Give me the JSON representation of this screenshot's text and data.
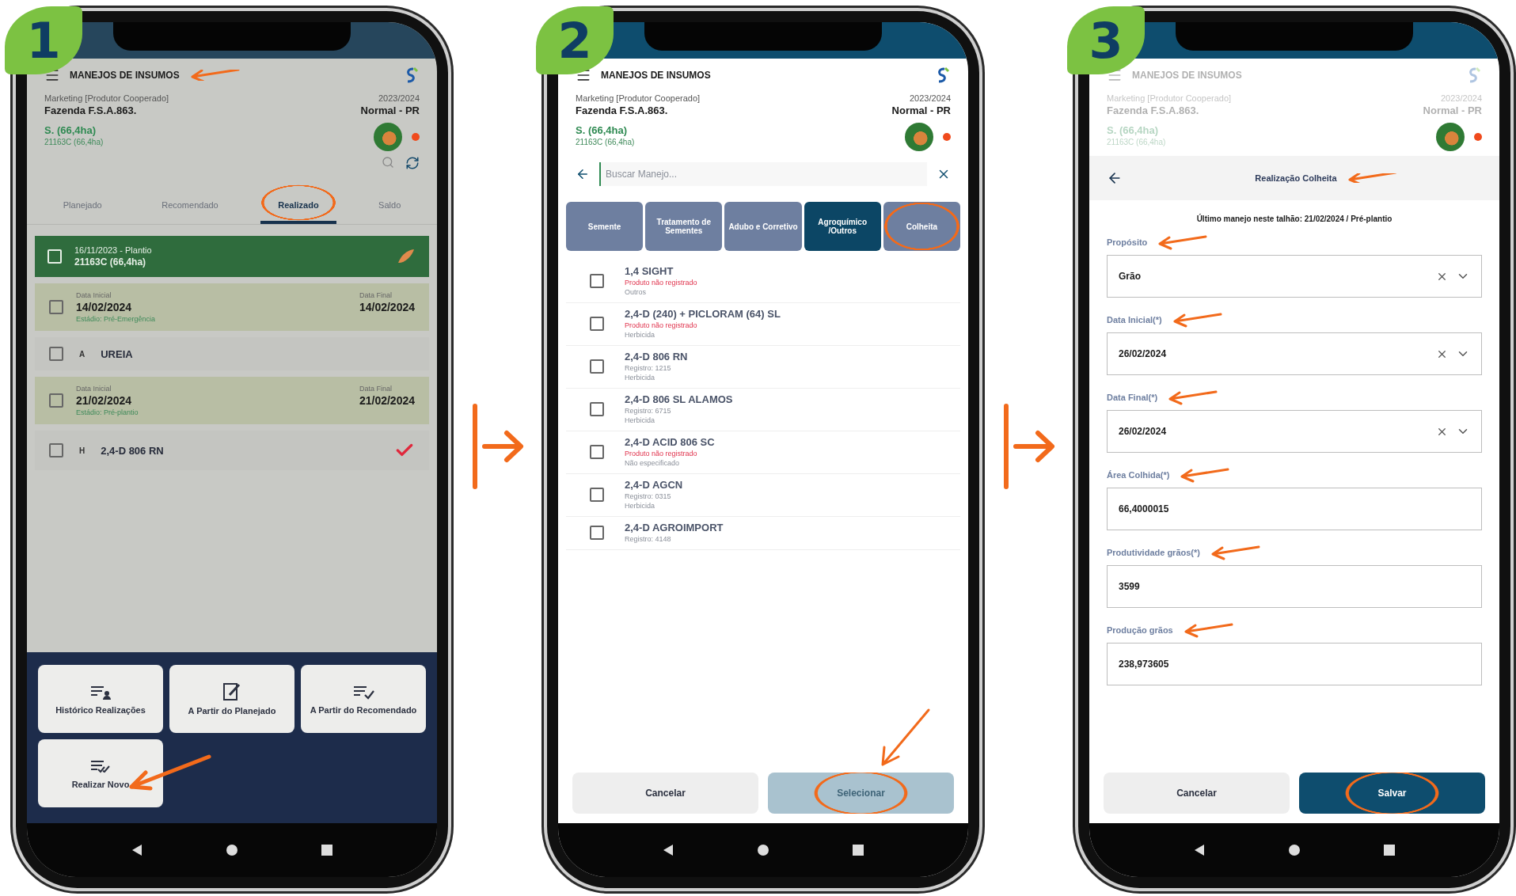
{
  "steps": [
    {
      "number": "1",
      "kind": "list",
      "header": {
        "title": "MANEJOS DE INSUMOS",
        "pointed": true,
        "faded": false
      },
      "farm": {
        "group": "Marketing [Produtor Cooperado]",
        "name": "Fazenda F.S.A.863.",
        "field": "S. (66,4ha)",
        "plot": "21163C (66,4ha)",
        "season": "2023/2024",
        "region": "Normal - PR"
      },
      "tabs": [
        {
          "label": "Planejado",
          "selected": false,
          "circled": false
        },
        {
          "label": "Recomendado",
          "selected": false,
          "circled": false
        },
        {
          "label": "Realizado",
          "selected": true,
          "circled": true
        },
        {
          "label": "Saldo",
          "selected": false,
          "circled": false
        }
      ],
      "entries": [
        {
          "kind": "planting",
          "title": "16/11/2023 - Plantio",
          "subtitle": "21163C (66,4ha)",
          "checked": false
        },
        {
          "kind": "stage",
          "start_label": "Data Inicial",
          "start": "14/02/2024",
          "end_label": "Data Final",
          "end": "14/02/2024",
          "stage": "Estádio: Pré-Emergência",
          "checked": false
        },
        {
          "kind": "product",
          "badge": "A",
          "name": "UREIA",
          "applied": false,
          "checked": false
        },
        {
          "kind": "stage",
          "start_label": "Data Inicial",
          "start": "21/02/2024",
          "end_label": "Data Final",
          "end": "21/02/2024",
          "stage": "Estádio: Pré-plantio",
          "checked": false
        },
        {
          "kind": "product",
          "badge": "H",
          "name": "2,4-D 806 RN",
          "applied": true,
          "checked": false
        }
      ],
      "actions": [
        {
          "label": "Histórico Realizações",
          "kind": "history",
          "pointed": false
        },
        {
          "label": "A Partir do Planejado",
          "kind": "plan",
          "pointed": false
        },
        {
          "label": "A Partir do Recomendado",
          "kind": "recommend",
          "pointed": false
        },
        {
          "label": "Realizar Novo",
          "kind": "new",
          "pointed": true
        }
      ]
    },
    {
      "number": "2",
      "kind": "catalog",
      "header": {
        "title": "MANEJOS DE INSUMOS",
        "pointed": false,
        "faded": false
      },
      "farm": {
        "group": "Marketing [Produtor Cooperado]",
        "name": "Fazenda F.S.A.863.",
        "field": "S. (66,4ha)",
        "plot": "21163C (66,4ha)",
        "season": "2023/2024",
        "region": "Normal - PR"
      },
      "search": {
        "placeholder": "Buscar Manejo..."
      },
      "categories": [
        {
          "label": "Semente",
          "selected": false,
          "circled": false
        },
        {
          "label": "Tratamento de Sementes",
          "selected": false,
          "circled": false
        },
        {
          "label": "Adubo e Corretivo",
          "selected": false,
          "circled": false
        },
        {
          "label": "Agroquímico /Outros",
          "selected": true,
          "circled": false
        },
        {
          "label": "Colheita",
          "selected": false,
          "circled": true
        }
      ],
      "products": [
        {
          "name": "1,4 SIGHT",
          "registered": false,
          "status": "Produto não registrado",
          "category": "Outros",
          "checked": false
        },
        {
          "name": "2,4-D (240) + PICLORAM (64) SL",
          "registered": false,
          "status": "Produto não registrado",
          "category": "Herbicida",
          "checked": false
        },
        {
          "name": "2,4-D 806 RN",
          "registered": true,
          "status": "Registro: 1215",
          "category": "Herbicida",
          "checked": false
        },
        {
          "name": "2,4-D 806 SL ALAMOS",
          "registered": true,
          "status": "Registro: 6715",
          "category": "Herbicida",
          "checked": false
        },
        {
          "name": "2,4-D ACID 806 SC",
          "registered": false,
          "status": "Produto não registrado",
          "category": "Não especificado",
          "checked": false
        },
        {
          "name": "2,4-D AGCN",
          "registered": true,
          "status": "Registro: 0315",
          "category": "Herbicida",
          "checked": false
        },
        {
          "name": "2,4-D AGROIMPORT",
          "registered": true,
          "status": "Registro: 4148",
          "checked": false
        }
      ],
      "buttons": [
        {
          "label": "Cancelar",
          "kind": "secondary",
          "disabled": false,
          "circled": false
        },
        {
          "label": "Selecionar",
          "kind": "primary",
          "disabled": true,
          "circled": true
        }
      ]
    },
    {
      "number": "3",
      "kind": "form",
      "header": {
        "title": "MANEJOS DE INSUMOS",
        "pointed": false,
        "faded": true
      },
      "farm": {
        "group": "Marketing [Produtor Cooperado]",
        "name": "Fazenda F.S.A.863.",
        "field": "S. (66,4ha)",
        "plot": "21163C (66,4ha)",
        "season": "2023/2024",
        "region": "Normal - PR"
      },
      "form": {
        "title": "Realização Colheita",
        "title_pointed": true,
        "note": "Último manejo neste talhão: 21/02/2024 / Pré-plantio",
        "fields": [
          {
            "label": "Propósito",
            "value": "Grão",
            "kind": "select",
            "pointed": true
          },
          {
            "label": "Data Inicial(*)",
            "value": "26/02/2024",
            "kind": "select",
            "pointed": true
          },
          {
            "label": "Data Final(*)",
            "value": "26/02/2024",
            "kind": "select",
            "pointed": true
          },
          {
            "label": "Área Colhida(*)",
            "value": "66,4000015",
            "kind": "input",
            "pointed": true
          },
          {
            "label": "Produtividade grãos(*)",
            "value": "3599",
            "kind": "input",
            "pointed": true
          },
          {
            "label": "Produção grãos",
            "value": "238,973605",
            "kind": "input",
            "pointed": true
          }
        ]
      },
      "buttons": [
        {
          "label": "Cancelar",
          "kind": "secondary",
          "disabled": false,
          "circled": false
        },
        {
          "label": "Salvar",
          "kind": "primary",
          "disabled": false,
          "circled": true
        }
      ]
    }
  ]
}
